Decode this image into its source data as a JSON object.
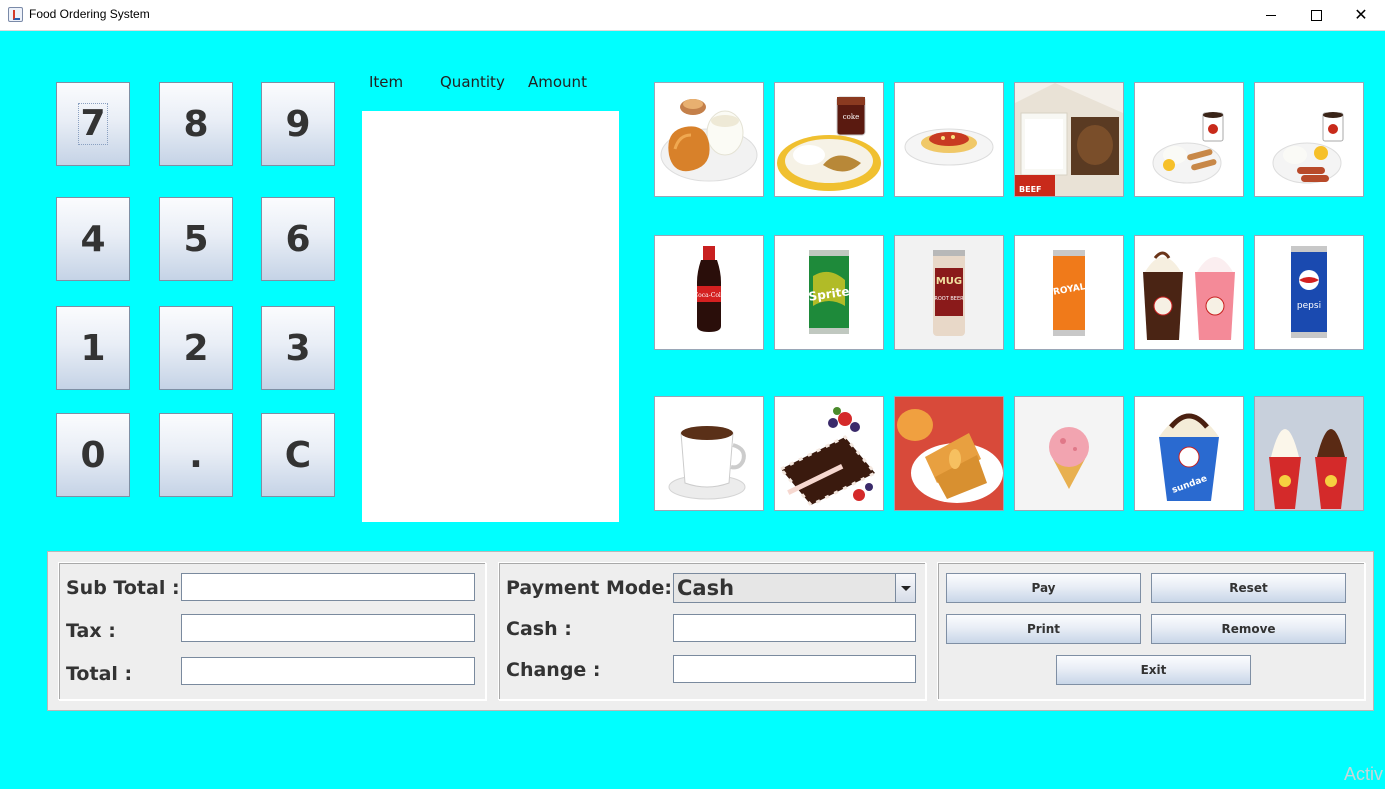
{
  "window": {
    "title": "Food Ordering System"
  },
  "keypad": {
    "keys": [
      "7",
      "8",
      "9",
      "4",
      "5",
      "6",
      "1",
      "2",
      "3",
      "0",
      ".",
      "C"
    ]
  },
  "order_table": {
    "columns": [
      "Item",
      "Quantity",
      "Amount"
    ],
    "rows": []
  },
  "menu": {
    "meals": [
      "fried-chicken-rice-meal",
      "chicken-rice-cola-meal",
      "spaghetti-meal",
      "beef-rice-meal",
      "longganisa-breakfast-meal",
      "hotdog-breakfast-meal"
    ],
    "drinks": [
      "coca-cola-bottle",
      "sprite-can",
      "mug-root-beer-can",
      "royal-can",
      "float-drinks",
      "pepsi-can"
    ],
    "desserts": [
      "hot-coffee",
      "chocolate-cake-slice",
      "peach-mango-pie",
      "ice-cream-cone",
      "sundae-cup",
      "soft-serve-cones"
    ]
  },
  "totals": {
    "subtotal_label": "Sub Total :",
    "tax_label": "Tax :",
    "total_label": "Total :",
    "subtotal_value": "",
    "tax_value": "",
    "total_value": ""
  },
  "payment": {
    "mode_label": "Payment Mode:",
    "mode_value": "Cash",
    "cash_label": "Cash :",
    "change_label": "Change :",
    "cash_value": "",
    "change_value": ""
  },
  "actions": {
    "pay": "Pay",
    "reset": "Reset",
    "print": "Print",
    "remove": "Remove",
    "exit": "Exit"
  },
  "colors": {
    "background": "#00ffff",
    "panel": "#eeeeee"
  },
  "watermark": "Activ"
}
